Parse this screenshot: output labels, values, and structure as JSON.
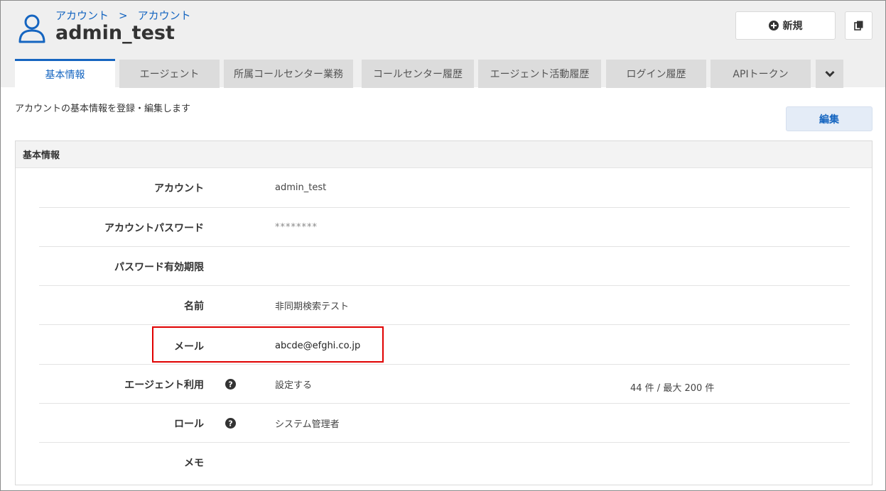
{
  "header": {
    "breadcrumb": [
      "アカウント",
      "アカウント"
    ],
    "breadcrumb_separator": ">",
    "title": "admin_test",
    "new_button_label": "新規",
    "new_button_icon": "plus-circle-icon",
    "copy_button_icon": "copy-icon"
  },
  "tabs": [
    {
      "label": "基本情報",
      "active": true
    },
    {
      "label": "エージェント",
      "active": false
    },
    {
      "label": "所属コールセンター業務",
      "active": false
    },
    {
      "label": "コールセンター履歴",
      "active": false
    },
    {
      "label": "エージェント活動履歴",
      "active": false
    },
    {
      "label": "ログイン履歴",
      "active": false
    },
    {
      "label": "APIトークン",
      "active": false
    }
  ],
  "tabs_more_icon": "chevron-down-icon",
  "description": "アカウントの基本情報を登録・編集します",
  "edit_button_label": "編集",
  "panel": {
    "title": "基本情報",
    "rows": [
      {
        "label": "アカウント",
        "value": "admin_test"
      },
      {
        "label": "アカウントパスワード",
        "value": "********"
      },
      {
        "label": "パスワード有効期限",
        "value": ""
      },
      {
        "label": "名前",
        "value": "非同期検索テスト"
      },
      {
        "label": "メール",
        "value": "abcde@efghi.co.jp"
      },
      {
        "label": "エージェント利用",
        "value": "設定する",
        "help": true,
        "extra": "44 件 / 最大 200 件"
      },
      {
        "label": "ロール",
        "value": "システム管理者",
        "help": true
      },
      {
        "label": "メモ",
        "value": ""
      }
    ]
  },
  "colors": {
    "accent": "#1565c0",
    "highlight": "#e00000",
    "tab_inactive": "#dcdcdc",
    "header_background": "#efefef"
  }
}
